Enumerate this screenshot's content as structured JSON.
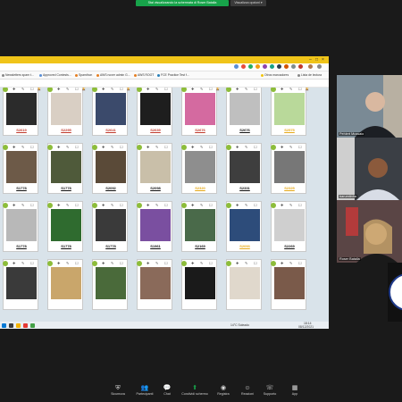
{
  "banner": {
    "sharing_text": "Stai visualizzando la schermata di Roser Batalla",
    "options_label": "Visualizza opzioni ▾"
  },
  "browser": {
    "bookmarks": [
      "Newsletters spam t...",
      "Approved Contests...",
      "Spamihon",
      "AWS noxer admin G...",
      "AWS ROOT",
      "FCE Practice Test f...",
      "Otros marcadores",
      "Lista de lectura"
    ]
  },
  "gallery": {
    "rows": [
      [
        {
          "num": "S2619",
          "color": "#c0392b"
        },
        {
          "num": "S2295",
          "color": "#c0392b"
        },
        {
          "num": "S2641",
          "color": "#c0392b"
        },
        {
          "num": "S2639",
          "color": "#c0392b"
        },
        {
          "num": "S2676",
          "color": "#c0392b"
        },
        {
          "num": "S2676",
          "color": "#111111"
        },
        {
          "num": "S2575",
          "color": "#e6a817"
        }
      ],
      [
        {
          "num": "S1778",
          "color": "#111111"
        },
        {
          "num": "S1778",
          "color": "#111111"
        },
        {
          "num": "S2092",
          "color": "#111111"
        },
        {
          "num": "S2098",
          "color": "#111111"
        },
        {
          "num": "S2320",
          "color": "#e6a817"
        },
        {
          "num": "S2331",
          "color": "#111111"
        },
        {
          "num": "S2325",
          "color": "#e6a817"
        }
      ],
      [
        {
          "num": "S1778",
          "color": "#111111"
        },
        {
          "num": "S1778",
          "color": "#111111"
        },
        {
          "num": "S1778",
          "color": "#111111"
        },
        {
          "num": "S1961",
          "color": "#111111"
        },
        {
          "num": "S2169",
          "color": "#111111"
        },
        {
          "num": "S2093",
          "color": "#e6a817"
        },
        {
          "num": "S2269",
          "color": "#111111"
        }
      ],
      [
        {
          "num": "",
          "color": "#111111"
        },
        {
          "num": "",
          "color": "#111111"
        },
        {
          "num": "",
          "color": "#111111"
        },
        {
          "num": "",
          "color": "#111111"
        },
        {
          "num": "",
          "color": "#111111"
        },
        {
          "num": "",
          "color": "#111111"
        },
        {
          "num": "",
          "color": "#111111"
        }
      ]
    ]
  },
  "taskbar": {
    "weather": "14°C  Soleado",
    "time": "18:14",
    "date": "08/12/2021"
  },
  "participants": [
    {
      "name": "Pehlert Mussaio"
    },
    {
      "name": "barumtinha"
    },
    {
      "name": "Roser Batalla"
    }
  ],
  "controls": [
    {
      "label": "Sicurezza",
      "icon": "shield-icon",
      "glyph": "⛨"
    },
    {
      "label": "Partecipanti",
      "icon": "participants-icon",
      "glyph": "👥"
    },
    {
      "label": "Chat",
      "icon": "chat-icon",
      "glyph": "💬"
    },
    {
      "label": "Condividi schermo",
      "icon": "share-screen-icon",
      "glyph": "⬆",
      "accent": "#17a34a"
    },
    {
      "label": "Registra",
      "icon": "record-icon",
      "glyph": "◉"
    },
    {
      "label": "Reazioni",
      "icon": "reactions-icon",
      "glyph": "☺"
    },
    {
      "label": "Supporto",
      "icon": "support-icon",
      "glyph": "☏"
    },
    {
      "label": "App",
      "icon": "apps-icon",
      "glyph": "▦"
    }
  ],
  "colors": {
    "zoom_green": "#17a34a",
    "badge_green": "#8dbd3a",
    "trophy_red": "#c0392b",
    "chrome_yellow": "#f0c419"
  }
}
